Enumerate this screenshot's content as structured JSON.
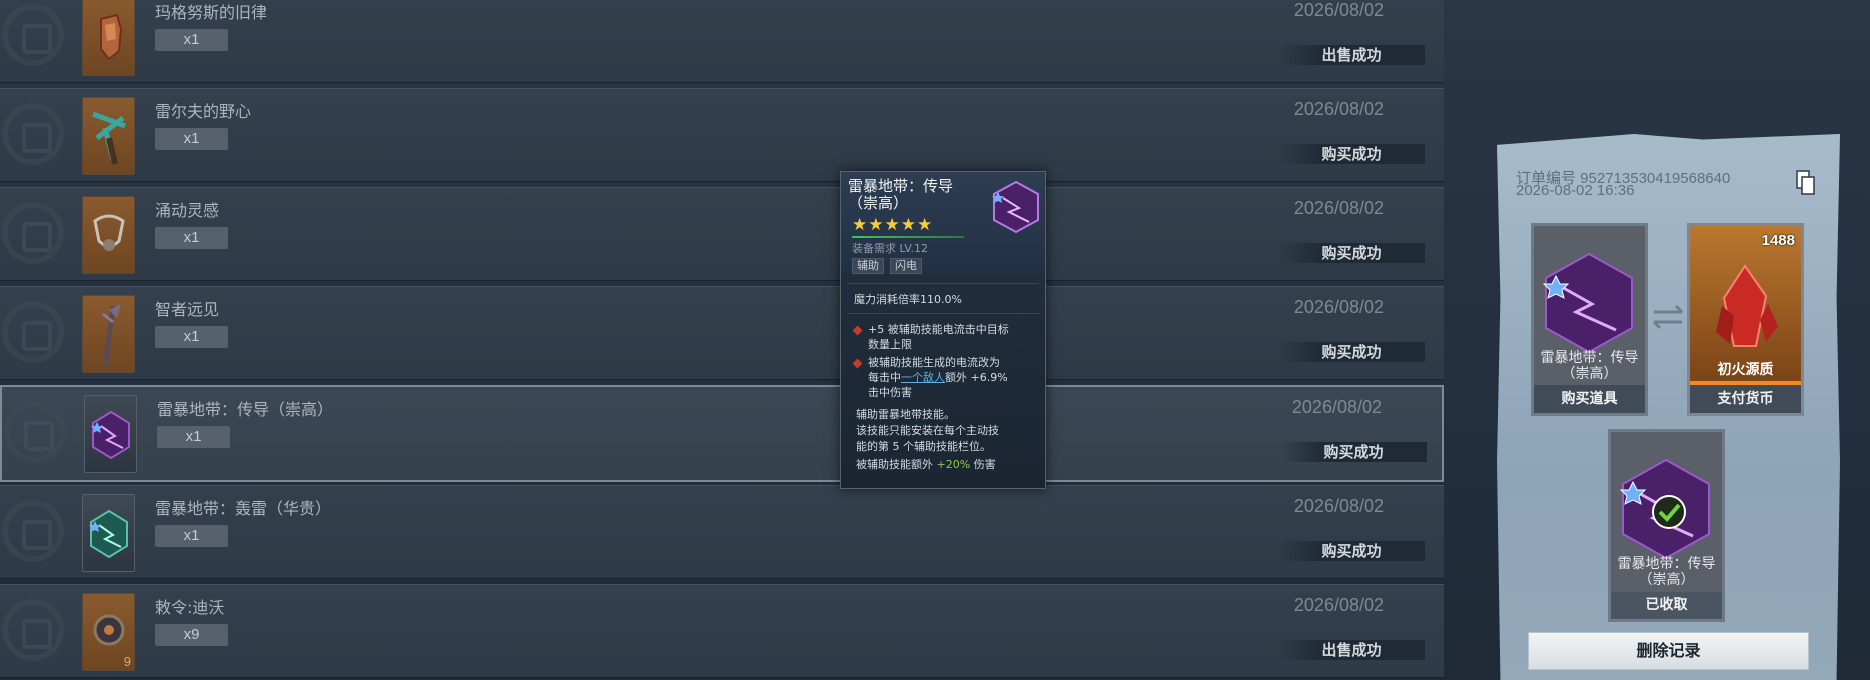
{
  "rows": [
    {
      "name": "玛格努斯的旧律",
      "qty": "x1",
      "date": "2026/08/02",
      "status": "出售成功",
      "thumb": "gauntlet-icon",
      "thumb_style": "orange"
    },
    {
      "name": "雷尔夫的野心",
      "qty": "x1",
      "date": "2026/08/02",
      "status": "购买成功",
      "thumb": "crossbow-icon",
      "thumb_style": "orange"
    },
    {
      "name": "涌动灵感",
      "qty": "x1",
      "date": "2026/08/02",
      "status": "购买成功",
      "thumb": "amulet-icon",
      "thumb_style": "orange"
    },
    {
      "name": "智者远见",
      "qty": "x1",
      "date": "2026/08/02",
      "status": "购买成功",
      "thumb": "staff-icon",
      "thumb_style": "orange"
    },
    {
      "name": "雷暴地带：传导（崇高）",
      "qty": "x1",
      "date": "2026/08/02",
      "status": "购买成功",
      "thumb": "purple-gem-icon",
      "thumb_style": "grey"
    },
    {
      "name": "雷暴地带：轰雷（华贵）",
      "qty": "x1",
      "date": "2026/08/02",
      "status": "购买成功",
      "thumb": "green-gem-icon",
      "thumb_style": "grey"
    },
    {
      "name": "敕令:迪沃",
      "qty": "x9",
      "date": "2026/08/02",
      "status": "出售成功",
      "thumb": "decree-icon",
      "thumb_style": "orange",
      "stack": "9"
    }
  ],
  "tooltip": {
    "title": "雷暴地带：传导（崇高）",
    "stars": "★★★★★",
    "requirement": "装备需求 LV.12",
    "tags": [
      "辅助",
      "闪电"
    ],
    "mana": "魔力消耗倍率110.0%",
    "bullet1_lines": [
      "+5 被辅助技能电流击中目标",
      "数量上限"
    ],
    "bullet2_line1": "被辅助技能生成的电流改为",
    "bullet2_line2_pre": "每击中",
    "bullet2_link": "一个敌人",
    "bullet2_line2_post": "额外 +6.9%",
    "bullet2_line3": "击中伤害",
    "desc_lines": [
      "辅助雷暴地带技能。",
      "该技能只能安装在每个主动技",
      "能的第 5 个辅助技能栏位。"
    ],
    "last_pre": "被辅助技能额外 ",
    "last_green": "+20%",
    "last_post": " 伤害"
  },
  "order": {
    "number": "订单编号 952713530419568640",
    "date": "2026-08-02 16:36",
    "bought_item_caption": "雷暴地带：传导（崇高）",
    "bought_label": "购买道具",
    "currency_name": "初火源质",
    "currency_amount": "1488",
    "currency_label": "支付货币",
    "received_caption": "雷暴地带：传导（崇高）",
    "received_label": "已收取",
    "delete_label": "删除记录"
  },
  "colors": {
    "accent_star": "#f5cd3a",
    "link": "#5fb2e6",
    "bonus": "#7fd04a",
    "bullet": "#c8382c"
  }
}
